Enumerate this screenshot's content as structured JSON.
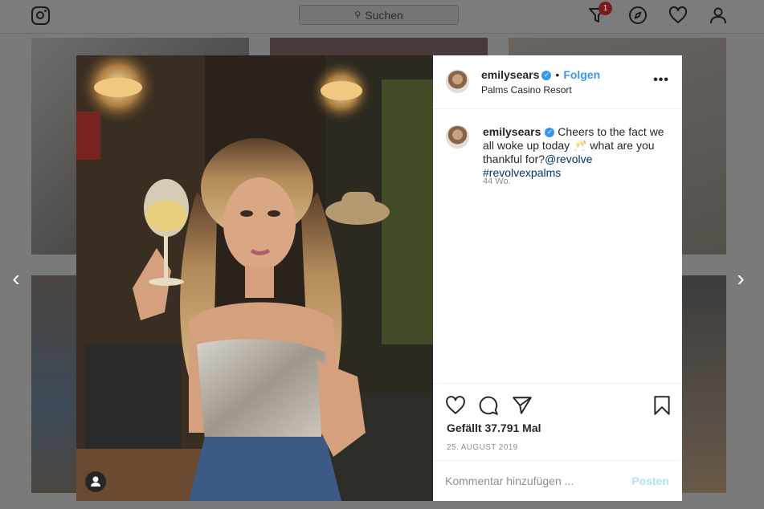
{
  "nav": {
    "search_placeholder": "Suchen",
    "notification_count": "1",
    "icons": [
      "instagram-logo",
      "activity-filter-icon",
      "compass-icon",
      "heart-icon",
      "profile-icon"
    ]
  },
  "post": {
    "username": "emilysears",
    "follow_label": "Folgen",
    "separator": "•",
    "location": "Palms Casino Resort",
    "more_label": "•••",
    "caption_text": "Cheers to the fact we all woke up today 🥂 what are you thankful for?",
    "mention": "@revolve",
    "hashtag": "#revolvexpalms",
    "caption_age": "44 Wo.",
    "likes": "Gefällt 37.791 Mal",
    "date": "25. AUGUST 2019",
    "comment_placeholder": "Kommentar hinzufügen ...",
    "post_label": "Posten"
  },
  "colors": {
    "accent": "#3897f0",
    "link": "#003569",
    "post_disabled": "#b2dffc"
  }
}
